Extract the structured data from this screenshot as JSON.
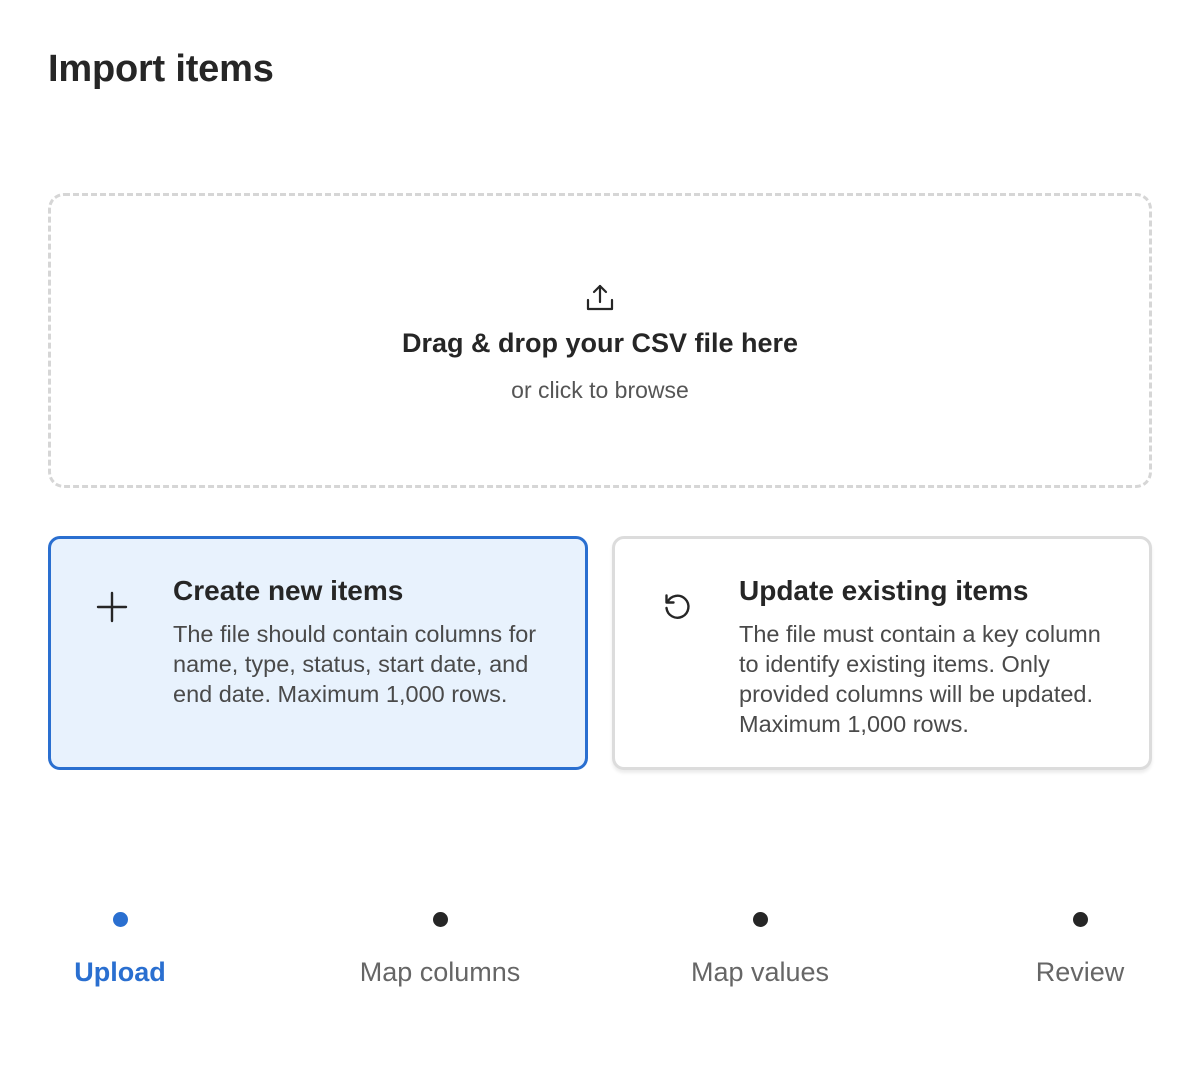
{
  "title": "Import items",
  "dropzone": {
    "icon": "upload-icon",
    "title": "Drag & drop your CSV file here",
    "subtitle": "or click to browse"
  },
  "cards": {
    "create": {
      "icon": "plus-icon",
      "title": "Create new items",
      "description": "The file should contain columns for name, type, status, start date, and end date. Maximum 1,000 rows.",
      "selected": true
    },
    "update": {
      "icon": "refresh-icon",
      "title": "Update existing items",
      "description": "The file must contain a key column to identify existing items. Only provided columns will be updated. Maximum 1,000 rows.",
      "selected": false
    }
  },
  "steps": [
    {
      "label": "Upload",
      "active": true
    },
    {
      "label": "Map columns",
      "active": false
    },
    {
      "label": "Map values",
      "active": false
    },
    {
      "label": "Review",
      "active": false
    }
  ],
  "colors": {
    "accent": "#2a6fd0",
    "selected_card_bg": "#e8f2fd",
    "text": "#262626",
    "muted": "#666666"
  }
}
